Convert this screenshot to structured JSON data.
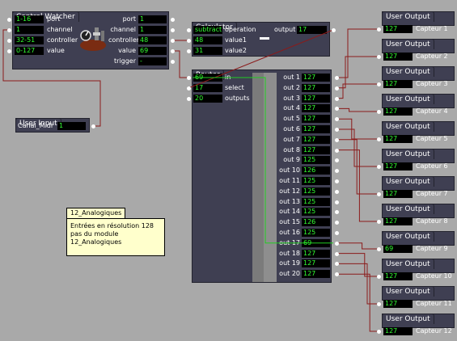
{
  "control_watcher": {
    "title": "Control Watcher",
    "inputs": [
      {
        "value": "1-16",
        "label": "port"
      },
      {
        "value": "1",
        "label": "channel"
      },
      {
        "value": "32-51",
        "label": "controller"
      },
      {
        "value": "0-127",
        "label": "value"
      }
    ],
    "outputs": [
      {
        "label": "port",
        "value": "1"
      },
      {
        "label": "channel",
        "value": "1"
      },
      {
        "label": "controller",
        "value": "48"
      },
      {
        "label": "value",
        "value": "69"
      },
      {
        "label": "trigger",
        "value": "-"
      }
    ]
  },
  "calculator": {
    "title": "Calculator",
    "inputs": [
      {
        "value": "subtract",
        "label": "operation"
      },
      {
        "value": "48",
        "label": "value1"
      },
      {
        "value": "31",
        "label": "value2"
      }
    ],
    "output": {
      "label": "output",
      "value": "17"
    }
  },
  "user_input": {
    "title": "User Input",
    "label": "Canal_Midi",
    "value": "1"
  },
  "comment": {
    "title": "12_Analogiques",
    "lines": [
      "Entrées en résolution 128",
      "pas du module",
      "12_Analogiques"
    ]
  },
  "router": {
    "title": "Router",
    "inputs": [
      {
        "value": "69",
        "label": "in"
      },
      {
        "value": "17",
        "label": "select"
      },
      {
        "value": "20",
        "label": "outputs"
      }
    ],
    "outputs": [
      {
        "label": "out 1",
        "value": "127"
      },
      {
        "label": "out 2",
        "value": "127"
      },
      {
        "label": "out 3",
        "value": "127"
      },
      {
        "label": "out 4",
        "value": "127"
      },
      {
        "label": "out 5",
        "value": "127"
      },
      {
        "label": "out 6",
        "value": "127"
      },
      {
        "label": "out 7",
        "value": "127"
      },
      {
        "label": "out 8",
        "value": "127"
      },
      {
        "label": "out 9",
        "value": "125"
      },
      {
        "label": "out 10",
        "value": "126"
      },
      {
        "label": "out 11",
        "value": "125"
      },
      {
        "label": "out 12",
        "value": "125"
      },
      {
        "label": "out 13",
        "value": "125"
      },
      {
        "label": "out 14",
        "value": "125"
      },
      {
        "label": "out 15",
        "value": "126"
      },
      {
        "label": "out 16",
        "value": "125"
      },
      {
        "label": "out 17",
        "value": "69"
      },
      {
        "label": "out 18",
        "value": "127"
      },
      {
        "label": "out 19",
        "value": "127"
      },
      {
        "label": "out 20",
        "value": "127"
      }
    ]
  },
  "user_outputs": [
    {
      "title": "User Output",
      "value": "127",
      "label": "Capteur 1"
    },
    {
      "title": "User Output",
      "value": "127",
      "label": "Capteur 2"
    },
    {
      "title": "User Output",
      "value": "127",
      "label": "Capteur 3"
    },
    {
      "title": "User Output",
      "value": "127",
      "label": "Capteur 4"
    },
    {
      "title": "User Output",
      "value": "127",
      "label": "Capteur 5"
    },
    {
      "title": "User Output",
      "value": "127",
      "label": "Capteur 6"
    },
    {
      "title": "User Output",
      "value": "127",
      "label": "Capteur 7"
    },
    {
      "title": "User Output",
      "value": "127",
      "label": "Capteur 8"
    },
    {
      "title": "User Output",
      "value": "69",
      "label": "Capteur 9"
    },
    {
      "title": "User Output",
      "value": "127",
      "label": "Capteur 10"
    },
    {
      "title": "User Output",
      "value": "127",
      "label": "Capteur 11"
    },
    {
      "title": "User Output",
      "value": "127",
      "label": "Capteur 12"
    }
  ],
  "colors": {
    "background": "#a9a9a9",
    "actor": "#3f3f52",
    "value_text": "#33ff33",
    "wire": "#8b1a1a",
    "active_wire": "#22cc22",
    "comment": "#ffffcc"
  }
}
